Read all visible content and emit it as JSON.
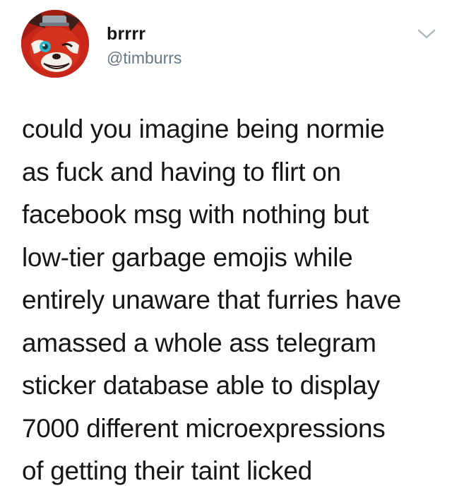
{
  "user": {
    "display_name": "brrrr",
    "handle": "@timburrs",
    "avatar_icon": "red-panda-avatar-icon"
  },
  "menu": {
    "icon": "chevron-down-icon",
    "color": "#aab8c2"
  },
  "tweet": {
    "lines": [
      "could you imagine being normie",
      "as fuck and having to flirt on",
      "facebook msg with nothing but",
      "low-tier garbage emojis while",
      "entirely unaware that furries have",
      "amassed a whole ass telegram",
      "sticker database able to display",
      "7000 different microexpressions",
      "of getting their taint licked"
    ]
  },
  "colors": {
    "text": "#14171a",
    "handle": "#657786",
    "background": "#ffffff"
  }
}
